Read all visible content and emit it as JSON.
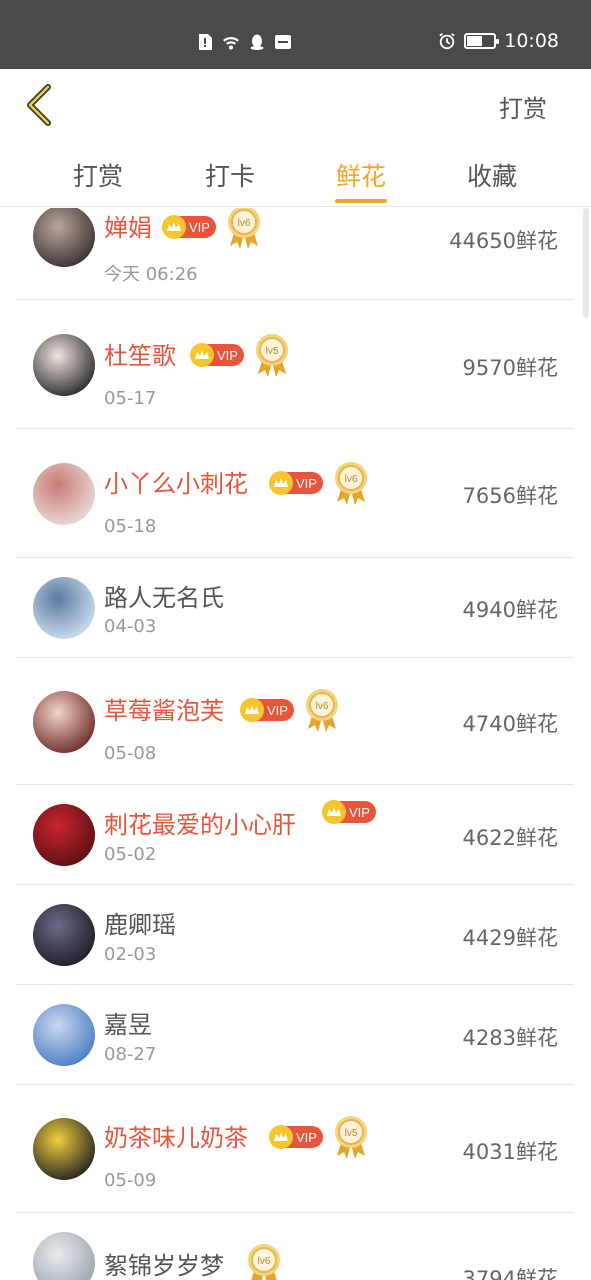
{
  "status_bar": {
    "time": "10:08",
    "battery_level": 0.55
  },
  "header": {
    "action_label": "打赏"
  },
  "tabs": [
    {
      "label": "打赏",
      "active": false
    },
    {
      "label": "打卡",
      "active": false
    },
    {
      "label": "鲜花",
      "active": true
    },
    {
      "label": "收藏",
      "active": false
    }
  ],
  "colors": {
    "accent": "#f5a623",
    "vip_name": "#e8553b",
    "vip_badge": "#e8553b",
    "level_gold": "#e7b74a"
  },
  "rows": [
    {
      "name": "婵娟",
      "date": "今天 06:26",
      "amount": "44650鲜花",
      "vip": true,
      "level": "lv6"
    },
    {
      "name": "杜笙歌",
      "date": "05-17",
      "amount": "9570鲜花",
      "vip": true,
      "level": "lv5"
    },
    {
      "name": "小丫么小刺花",
      "date": "05-18",
      "amount": "7656鲜花",
      "vip": true,
      "level": "lv6"
    },
    {
      "name": "路人无名氏",
      "date": "04-03",
      "amount": "4940鲜花",
      "vip": false,
      "level": ""
    },
    {
      "name": "草莓酱泡芙",
      "date": "05-08",
      "amount": "4740鲜花",
      "vip": true,
      "level": "lv6"
    },
    {
      "name": "刺花最爱的小心肝",
      "date": "05-02",
      "amount": "4622鲜花",
      "vip": true,
      "level": ""
    },
    {
      "name": "鹿卿瑶",
      "date": "02-03",
      "amount": "4429鲜花",
      "vip": false,
      "level": ""
    },
    {
      "name": "嘉昱",
      "date": "08-27",
      "amount": "4283鲜花",
      "vip": false,
      "level": ""
    },
    {
      "name": "奶茶味儿奶茶",
      "date": "05-09",
      "amount": "4031鲜花",
      "vip": true,
      "level": "lv5"
    },
    {
      "name": "絮锦岁岁梦",
      "date": "",
      "amount": "3794鲜花",
      "vip": false,
      "level": "lv6"
    }
  ],
  "vip_label": "VIP"
}
